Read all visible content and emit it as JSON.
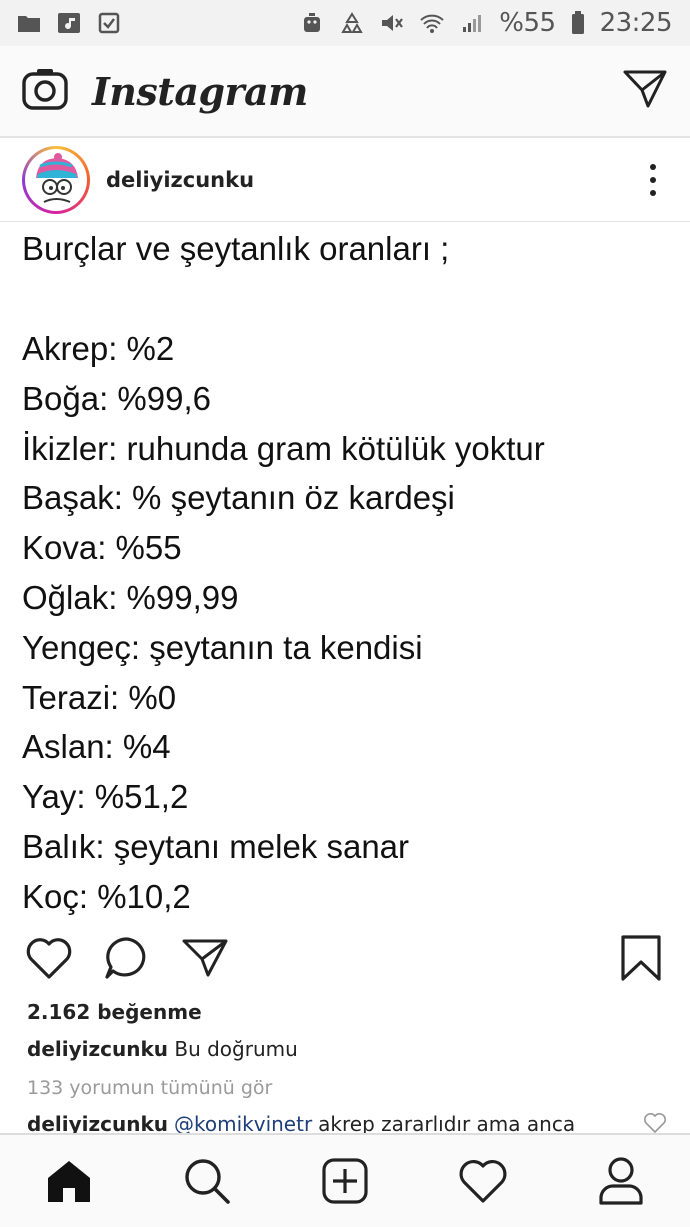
{
  "status_bar": {
    "battery_percent": "%55",
    "time": "23:25",
    "icons_left": [
      "folder-icon",
      "music-icon",
      "checkbox-icon"
    ],
    "icons_right": [
      "android-icon",
      "recycle-icon",
      "mute-icon",
      "wifi-icon",
      "signal-icon",
      "battery-icon"
    ]
  },
  "app_bar": {
    "title": "Instagram",
    "left_icon": "camera-icon",
    "right_icon": "direct-message-icon"
  },
  "post": {
    "username": "deliyizcunku",
    "title": "Burçlar ve şeytanlık oranları ;",
    "lines": [
      "Akrep: %2",
      "Boğa: %99,6",
      "İkizler: ruhunda gram kötülük yoktur",
      "Başak: % şeytanın öz kardeşi",
      "Kova: %55",
      "Oğlak: %99,99",
      "Yengeç: şeytanın ta kendisi",
      "Terazi: %0",
      "Aslan: %4",
      "Yay: %51,2",
      "Balık: şeytanı melek sanar",
      "Koç: %10,2"
    ],
    "likes": "2.162 beğenme",
    "caption_user": "deliyizcunku",
    "caption_text": "Bu doğrumu",
    "view_comments": "133 yorumun tümünü gör",
    "comment_user": "deliyizcunku",
    "comment_mention": "@komikvinetr",
    "comment_text": "akrep zararlıdır ama anca"
  },
  "bottom_nav": [
    "home-icon",
    "search-icon",
    "add-post-icon",
    "activity-heart-icon",
    "profile-icon"
  ]
}
